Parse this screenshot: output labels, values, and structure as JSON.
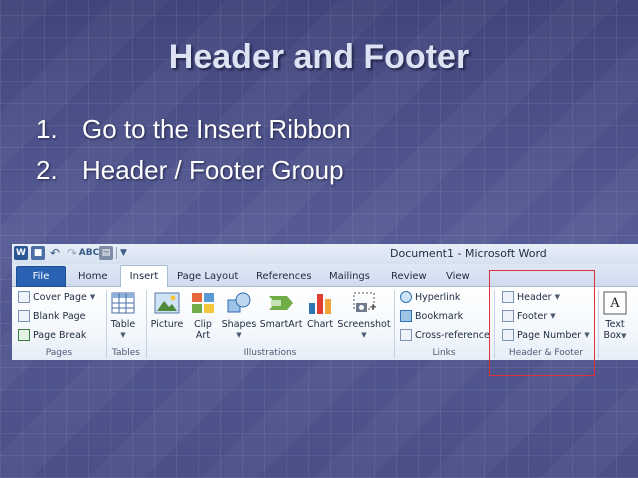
{
  "slide": {
    "title": "Header and Footer",
    "steps": [
      {
        "num": "1.",
        "text": "Go to the Insert Ribbon"
      },
      {
        "num": "2.",
        "text": "Header / Footer Group"
      }
    ]
  },
  "word": {
    "window_title": "Document1  -  Microsoft Word",
    "tabs": {
      "file": "File",
      "home": "Home",
      "insert": "Insert",
      "page_layout": "Page Layout",
      "references": "References",
      "mailings": "Mailings",
      "review": "Review",
      "view": "View"
    },
    "groups": {
      "pages": {
        "label": "Pages",
        "cover_page": "Cover Page",
        "blank_page": "Blank Page",
        "page_break": "Page Break"
      },
      "tables": {
        "label": "Tables",
        "table": "Table"
      },
      "illustrations": {
        "label": "Illustrations",
        "picture": "Picture",
        "clip_art_1": "Clip",
        "clip_art_2": "Art",
        "shapes": "Shapes",
        "smartart": "SmartArt",
        "chart": "Chart",
        "screenshot": "Screenshot"
      },
      "links": {
        "label": "Links",
        "hyperlink": "Hyperlink",
        "bookmark": "Bookmark",
        "cross_reference": "Cross-reference"
      },
      "header_footer": {
        "label": "Header & Footer",
        "header": "Header",
        "footer": "Footer",
        "page_number": "Page Number"
      },
      "text": {
        "text_box_1": "Text",
        "text_box_2": "Box"
      }
    },
    "colors": {
      "file_tab": "#2a62b3",
      "highlight": "#e0303a"
    }
  }
}
